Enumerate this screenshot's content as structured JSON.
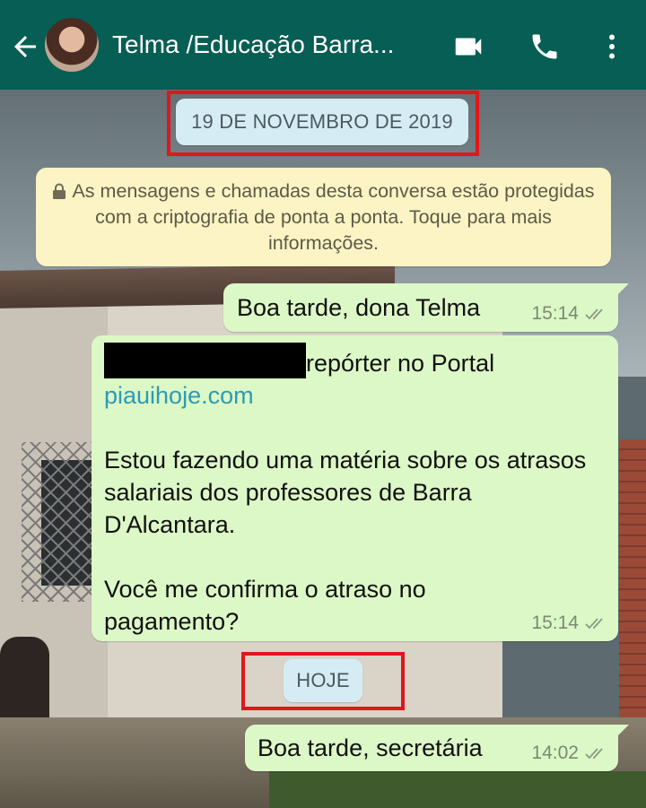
{
  "header": {
    "contact_name": "Telma /Educação Barra...",
    "back_icon": "arrow-left-icon",
    "video_icon": "video-camera-icon",
    "call_icon": "phone-icon",
    "menu_icon": "more-vertical-icon"
  },
  "chat": {
    "date_chip": "19 DE NOVEMBRO DE 2019",
    "today_chip": "HOJE",
    "encryption_notice": "As mensagens e chamadas desta conversa estão protegidas com a criptografia de ponta a ponta. Toque para mais informações.",
    "messages": [
      {
        "text": "Boa tarde, dona Telma",
        "time": "15:14"
      },
      {
        "line1_after_redaction": "repórter no Portal",
        "link": "piauihoje.com",
        "paragraph2": "Estou fazendo uma matéria sobre os atrasos salariais dos professores de Barra D'Alcantara.",
        "paragraph3": "Você me confirma o atraso no pagamento?",
        "time": "15:14"
      },
      {
        "text": "Boa tarde, secretária",
        "time": "14:02"
      }
    ]
  },
  "colors": {
    "header_bg": "#075e54",
    "outgoing_bubble": "#dcf8c6",
    "notice_bg": "#fcf4c4",
    "chip_bg": "#d6ecf5",
    "highlight_box": "#e0161b",
    "link": "#2d9bb5"
  }
}
